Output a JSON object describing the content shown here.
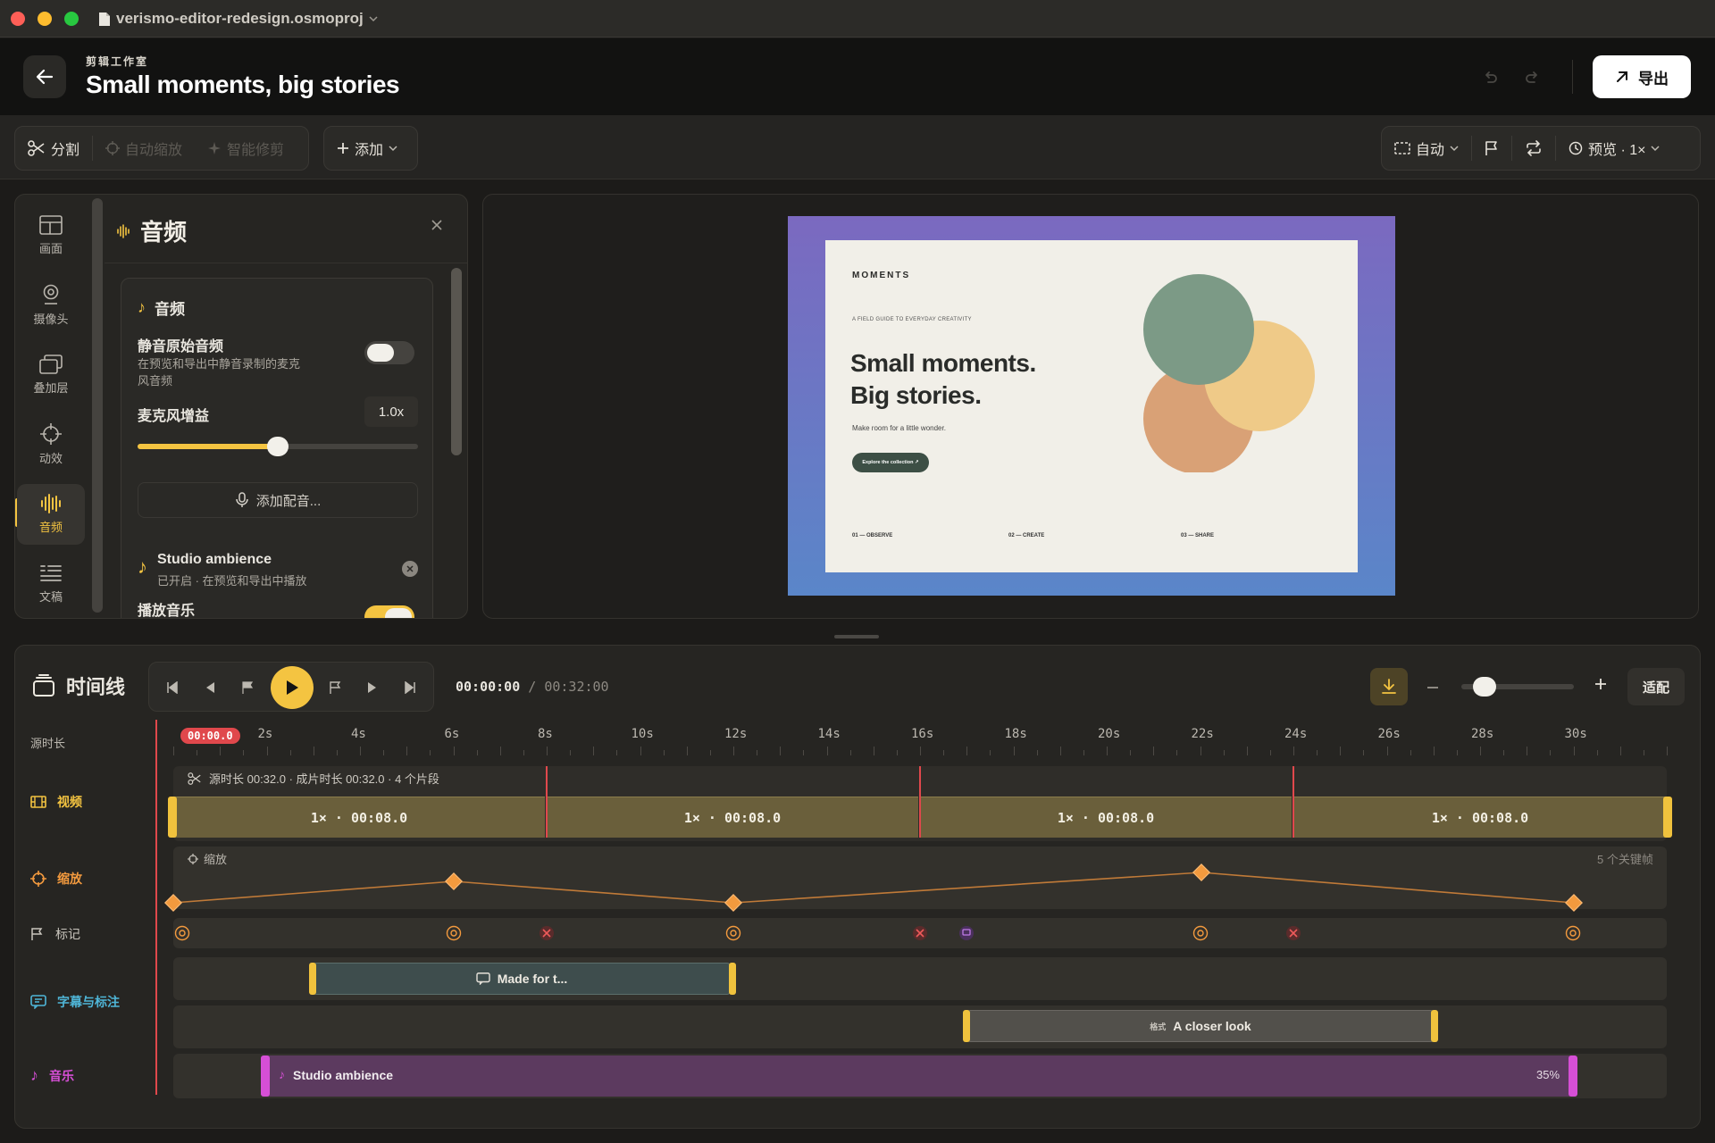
{
  "window": {
    "file_name": "verismo-editor-redesign.osmoproj",
    "traffic_lights": [
      "#fe5f57",
      "#febc2e",
      "#28c840"
    ]
  },
  "header": {
    "eyebrow": "剪辑工作室",
    "title": "Small moments, big stories",
    "export_label": "导出"
  },
  "toolbar": {
    "split_label": "分割",
    "auto_zoom_label": "自动缩放",
    "smart_trim_label": "智能修剪",
    "add_label": "添加",
    "aspect_label": "自动",
    "preview_label": "预览 · 1×"
  },
  "rail": {
    "items": [
      {
        "label": "画面",
        "icon": "layout-icon"
      },
      {
        "label": "摄像头",
        "icon": "camera-icon"
      },
      {
        "label": "叠加层",
        "icon": "overlay-icon"
      },
      {
        "label": "动效",
        "icon": "motion-icon"
      },
      {
        "label": "音频",
        "icon": "audio-icon"
      },
      {
        "label": "文稿",
        "icon": "script-icon"
      }
    ],
    "active": "音频"
  },
  "audio_panel": {
    "title": "音频",
    "section_title": "音频",
    "mute_title": "静音原始音频",
    "mute_desc_1": "在预览和导出中静音录制的麦克",
    "mute_desc_2": "风音频",
    "gain_label": "麦克风增益",
    "gain_value": "1.0x",
    "gain_fraction": 0.5,
    "add_voice_label": "添加配音...",
    "track_name": "Studio ambience",
    "track_status": "已开启 · 在预览和导出中播放",
    "play_music_label": "播放音乐",
    "mute_on": false,
    "play_music_on": true
  },
  "slide": {
    "brand": "MOMENTS",
    "kicker": "A FIELD GUIDE TO EVERYDAY CREATIVITY",
    "headline_1": "Small moments.",
    "headline_2": "Big stories.",
    "sub": "Make room for a little wonder.",
    "cta": "Explore the collection ↗",
    "footer": [
      "01 — OBSERVE",
      "02 — CREATE",
      "03 — SHARE"
    ],
    "colors": {
      "green": "#7c9a86",
      "peach": "#d9a176",
      "sand": "#efca88"
    }
  },
  "timeline": {
    "title": "时间线",
    "current_time": "00:00:00",
    "total_time": "00:32:00",
    "playhead_label": "00:00.0",
    "fit_label": "适配",
    "zoom_fraction": 0.1,
    "ruler_label": "源时长",
    "ticks": [
      "2s",
      "4s",
      "6s",
      "8s",
      "10s",
      "12s",
      "14s",
      "16s",
      "18s",
      "20s",
      "22s",
      "24s",
      "26s",
      "28s",
      "30s"
    ],
    "video_label": "视频",
    "video_summary": "源时长 00:32.0 · 成片时长 00:32.0 · 4 个片段",
    "clips": [
      "1× · 00:08.0",
      "1× · 00:08.0",
      "1× · 00:08.0",
      "1× · 00:08.0"
    ],
    "zoom_track_label": "缩放",
    "zoom_lane_title": "缩放",
    "keyframe_count": "5 个关键帧",
    "markers_label": "标记",
    "captions_label": "字幕与标注",
    "caption_1": "Made for t...",
    "caption_2_tag": "格式",
    "caption_2": "A closer look",
    "music_label": "音乐",
    "music_clip": "Studio ambience",
    "music_volume": "35%"
  }
}
